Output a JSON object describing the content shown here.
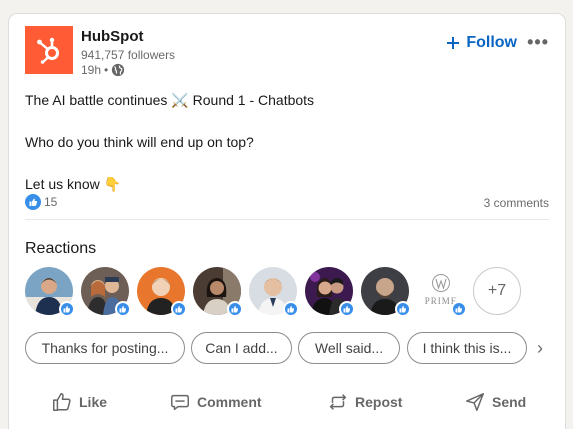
{
  "post": {
    "company_name": "HubSpot",
    "followers": "941,757 followers",
    "time": "19h",
    "bullet": "•",
    "follow_label": "Follow",
    "more_label": "•••",
    "text_line1": "The AI battle continues ⚔️ Round 1 - Chatbots",
    "text_line2": "Who do you think will end up on top?",
    "text_line3": "Let us know 👇",
    "reaction_count": "15",
    "comments_count": "3 comments"
  },
  "reactions": {
    "title": "Reactions",
    "more": "+7",
    "prime_label": "PRIME",
    "avatars": [
      {
        "bg": "#7ba4c4",
        "fg": "#3a3a3a"
      },
      {
        "bg": "#6e5f56",
        "fg": "#d8b08c"
      },
      {
        "bg": "#e8762d",
        "fg": "#f1d2b6"
      },
      {
        "bg": "#4a3b33",
        "fg": "#b98a6a"
      },
      {
        "bg": "#d7dde3",
        "fg": "#3c3027"
      },
      {
        "bg": "#3c1a4f",
        "fg": "#c99a83"
      },
      {
        "bg": "#3d3f44",
        "fg": "#c7a58b"
      },
      {
        "bg": "#ffffff",
        "fg": "#9a9a9a"
      }
    ]
  },
  "suggestions": [
    "Thanks for posting...",
    "Can I add...",
    "Well said...",
    "I think this is..."
  ],
  "actions": {
    "like": "Like",
    "comment": "Comment",
    "repost": "Repost",
    "send": "Send"
  },
  "colors": {
    "brand": "#ff5c35",
    "accent": "#0a66c2",
    "reaction_blue": "#378fe9"
  }
}
